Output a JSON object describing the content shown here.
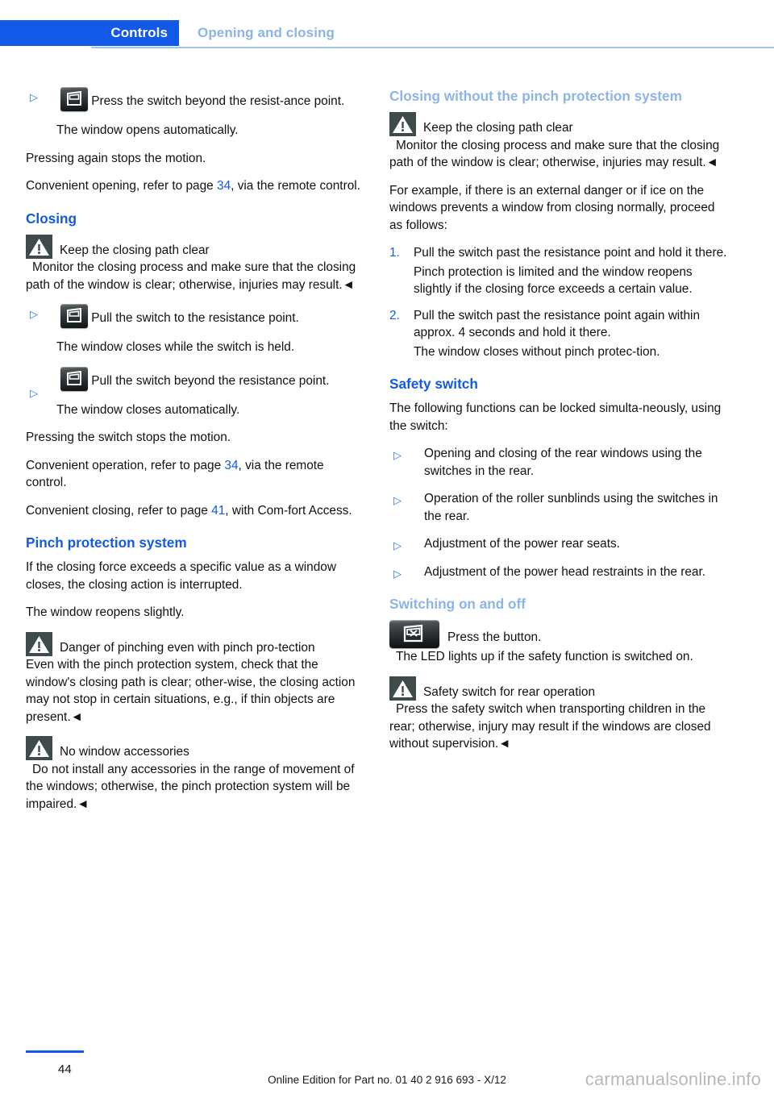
{
  "header": {
    "tab_label": "Controls",
    "section_label": "Opening and closing"
  },
  "left_column": {
    "b1_text": "Press the switch beyond the resist-ance point.",
    "b1_sub": "The window opens automatically.",
    "p1": "Pressing again stops the motion.",
    "p2_pre": "Convenient opening, refer to page ",
    "p2_ref": "34",
    "p2_post": ", via the remote control.",
    "h_closing": "Closing",
    "warn1_title": "Keep the closing path clear",
    "warn1_body": "Monitor the closing process and make sure that the closing path of the window is clear; otherwise, injuries may result.◄",
    "b2_text": "Pull the switch to the resistance point.",
    "b2_sub": "The window closes while the switch is held.",
    "b3_text": "Pull the switch beyond the resistance point.",
    "b3_sub": "The window closes automatically.",
    "p3": "Pressing the switch stops the motion.",
    "p4_pre": "Convenient operation, refer to page ",
    "p4_ref": "34",
    "p4_post": ", via the remote control.",
    "p5_pre": "Convenient closing, refer to page ",
    "p5_ref": "41",
    "p5_post": ", with Com-fort Access.",
    "h_pinch": "Pinch protection system",
    "p6": "If the closing force exceeds a specific value as a window closes, the closing action is interrupted.",
    "p7": "The window reopens slightly.",
    "warn2_title": "Danger of pinching even with pinch pro-tection",
    "warn2_body": "Even with the pinch protection system, check that the window's closing path is clear; other-wise, the closing action may not stop in certain situations, e.g., if thin objects are present.◄",
    "warn3_title": "No window accessories",
    "warn3_body": "Do not install any accessories in the range of movement of the windows; otherwise, the pinch protection system will be impaired.◄"
  },
  "right_column": {
    "h_closing_without": "Closing without the pinch protection system",
    "warn4_title": "Keep the closing path clear",
    "warn4_body": "Monitor the closing process and make sure that the closing path of the window is clear; otherwise, injuries may result.◄",
    "p1": "For example, if there is an external danger or if ice on the windows prevents a window from closing normally, proceed as follows:",
    "step1_num": "1.",
    "step1_text": "Pull the switch past the resistance point and hold it there.",
    "step1_sub": "Pinch protection is limited and the window reopens slightly if the closing force exceeds a certain value.",
    "step2_num": "2.",
    "step2_text": "Pull the switch past the resistance point again within approx. 4 seconds and hold it there.",
    "step2_sub": "The window closes without pinch protec-tion.",
    "h_safety": "Safety switch",
    "p2": "The following functions can be locked simulta-neously, using the switch:",
    "bullets": [
      "Opening and closing of the rear windows using the switches in the rear.",
      "Operation of the roller sunblinds using the switches in the rear.",
      "Adjustment of the power rear seats.",
      "Adjustment of the power head restraints in the rear."
    ],
    "h_switching": "Switching on and off",
    "press_button": "Press the button.",
    "led_text": "The LED lights up if the safety function is switched on.",
    "warn5_title": "Safety switch for rear operation",
    "warn5_body": "Press the safety switch when transporting children in the rear; otherwise, injury may result if the windows are closed without supervision.◄"
  },
  "footer": {
    "page_number": "44",
    "edition_text": "Online Edition for Part no. 01 40 2 916 693 - X/12",
    "watermark": "carmanualsonline.info"
  },
  "colors": {
    "accent_blue": "#1359e8",
    "light_blue": "#8cb4e8",
    "warn_icon": "#3e4b4a"
  }
}
